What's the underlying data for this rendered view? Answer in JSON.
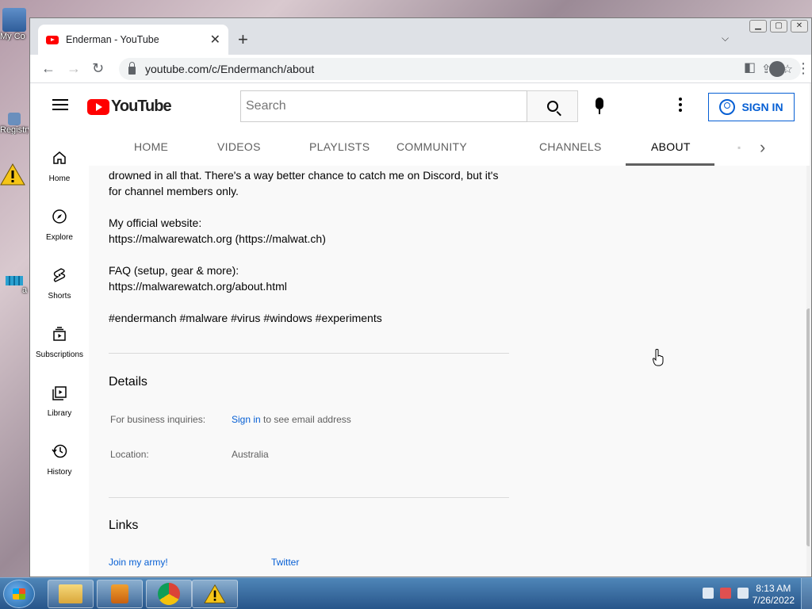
{
  "desktop": {
    "icons": [
      {
        "label": "My Co"
      },
      {
        "label": "Registry"
      },
      {
        "label": "a"
      }
    ]
  },
  "browser": {
    "tab_title": "Enderman - YouTube",
    "url": "youtube.com/c/Endermanch/about"
  },
  "youtube": {
    "search_placeholder": "Search",
    "sign_in_label": "SIGN IN",
    "guide": [
      {
        "label": "Home",
        "icon": "home-icon"
      },
      {
        "label": "Explore",
        "icon": "compass-icon"
      },
      {
        "label": "Shorts",
        "icon": "shorts-icon"
      },
      {
        "label": "Subscriptions",
        "icon": "subscriptions-icon"
      },
      {
        "label": "Library",
        "icon": "library-icon"
      },
      {
        "label": "History",
        "icon": "history-icon"
      }
    ],
    "tabs": [
      "HOME",
      "VIDEOS",
      "PLAYLISTS",
      "COMMUNITY",
      "CHANNELS",
      "ABOUT"
    ],
    "active_tab": "ABOUT",
    "description": {
      "lines": [
        "drowned in all that. There's a way better chance to catch me on Discord, but it's",
        "for channel members only.",
        "My official website:",
        "https://malwarewatch.org (https://malwat.ch)",
        "FAQ (setup, gear & more):",
        "https://malwarewatch.org/about.html",
        "#endermanch #malware #virus #windows #experiments"
      ]
    },
    "details": {
      "title": "Details",
      "business_label": "For business inquiries:",
      "business_link": "Sign in",
      "business_suffix": " to see email address",
      "location_label": "Location:",
      "location_value": "Australia"
    },
    "links": {
      "title": "Links",
      "items": [
        "Join my army!",
        "Twitter"
      ]
    }
  },
  "taskbar": {
    "time": "8:13 AM",
    "date": "7/26/2022"
  },
  "colors": {
    "youtube_red": "#ff0000",
    "link_blue": "#065fd4",
    "taskbar": "#2f6aa4"
  }
}
